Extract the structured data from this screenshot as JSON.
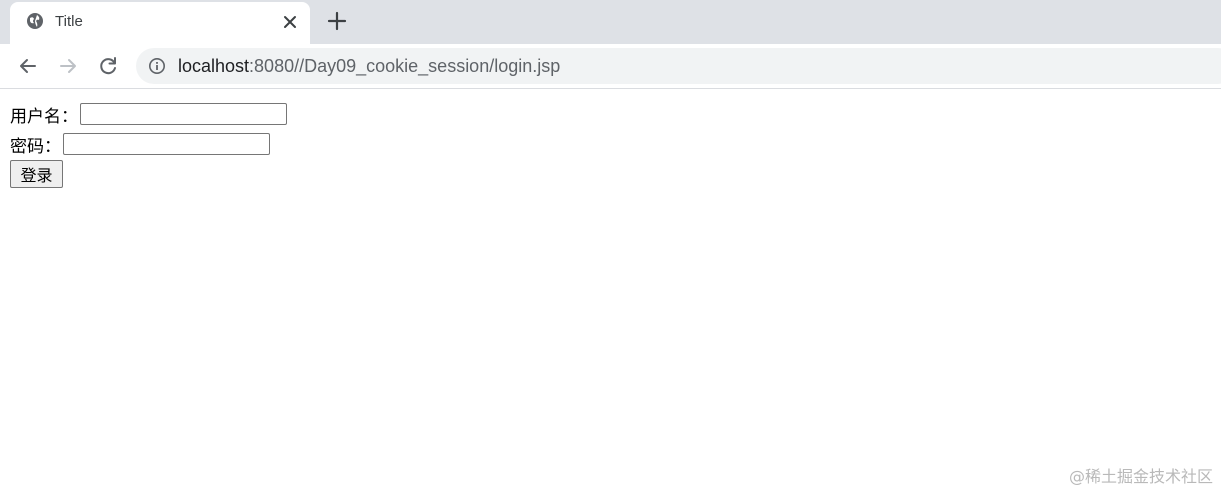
{
  "browser": {
    "tab": {
      "title": "Title"
    },
    "icons": {
      "tab_favicon": "globe-icon",
      "tab_close": "close-icon",
      "new_tab": "plus-icon",
      "back": "arrow-left-icon",
      "forward": "arrow-right-icon",
      "reload": "reload-icon",
      "site_info": "info-icon"
    },
    "address": {
      "host": "localhost",
      "rest": ":8080//Day09_cookie_session/login.jsp"
    }
  },
  "form": {
    "username_label": "用户名：",
    "username_value": "",
    "password_label": "密码：",
    "password_value": "",
    "submit_label": "登录"
  },
  "watermark": "@稀土掘金技术社区",
  "colors": {
    "tabstrip_bg": "#dee1e6",
    "omnibox_bg": "#f1f3f4",
    "icon_gray": "#5f6368"
  }
}
